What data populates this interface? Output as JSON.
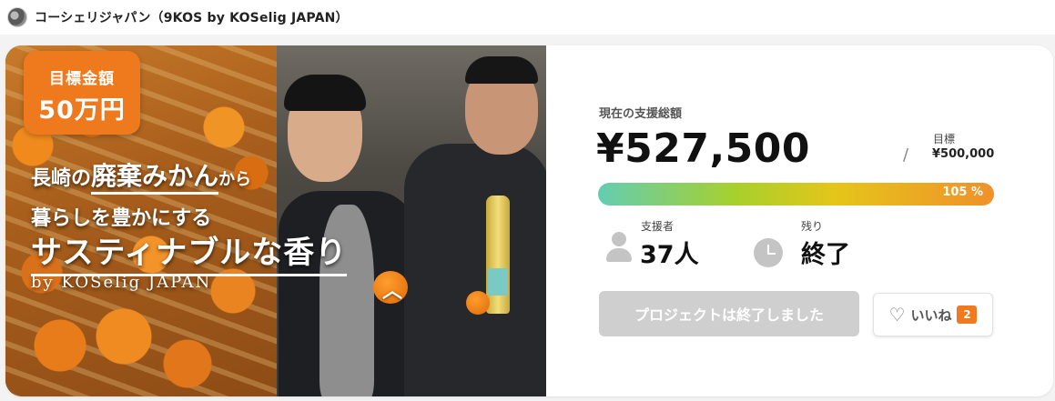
{
  "header": {
    "owner_name": "コーシェリジャパン（9KOS by KOSelig JAPAN）",
    "avatar_icon": "avatar-icon"
  },
  "hero": {
    "goal_badge_line1": "目標金額",
    "goal_badge_line2": "50万円",
    "line1_a": "長崎の",
    "line1_b": "廃棄みかん",
    "line1_c": "から",
    "line2": "暮らしを豊かにする",
    "line3": "サスティナブルな香り",
    "line4": "by KOSelig JAPAN",
    "chevron_icon": "chevron-up-icon"
  },
  "funding": {
    "raised_label": "現在の支援総額",
    "raised_amount": "¥527,500",
    "slash": "/",
    "goal_label": "目標",
    "goal_amount": "¥500,000",
    "progress_percent_text": "105 %",
    "progress_fraction": 1.05,
    "colors": {
      "gradient_start": "#63cdb2",
      "gradient_mid": "#e5c51a",
      "gradient_end": "#f0902a"
    }
  },
  "stats": {
    "supporters_label": "支援者",
    "supporters_value": "37人",
    "remaining_label": "残り",
    "remaining_value": "終了",
    "supporters_icon": "person-icon",
    "remaining_icon": "clock-icon"
  },
  "actions": {
    "ended_button_label": "プロジェクトは終了しました",
    "like_label": "いいね",
    "like_count": "2",
    "like_icon": "heart-icon",
    "accent_color": "#f07a1d"
  }
}
